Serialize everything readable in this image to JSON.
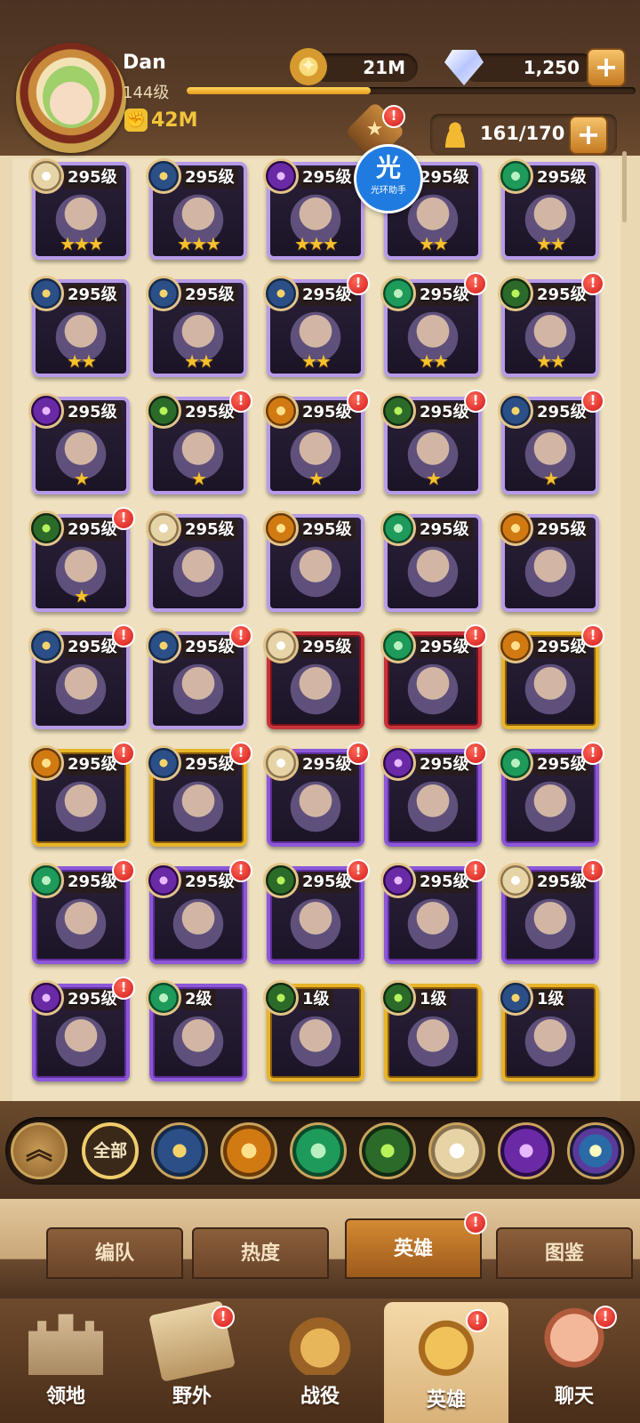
{
  "player": {
    "name": "Dan",
    "level": "144级",
    "power": "42M",
    "xp_progress": 0.41
  },
  "resources": {
    "gold": "21M",
    "diamonds": "1,250"
  },
  "roster": {
    "count": "161/170"
  },
  "watermark": {
    "symbol": "光",
    "label": "光环助手"
  },
  "colors": {
    "accent_gold": "#e8b428",
    "badge_red": "#d21a1a"
  },
  "heroes": [
    {
      "level": "295级",
      "stars": "★★★",
      "rarity": "lavender",
      "faction": "celestial",
      "badge": false
    },
    {
      "level": "295级",
      "stars": "★★★",
      "rarity": "lavender",
      "faction": "lightbearer",
      "badge": false
    },
    {
      "level": "295级",
      "stars": "★★★",
      "rarity": "lavender",
      "faction": "hypogean",
      "badge": false
    },
    {
      "level": "295级",
      "stars": "★★",
      "rarity": "lavender",
      "faction": "dimensional",
      "badge": false
    },
    {
      "level": "295级",
      "stars": "★★",
      "rarity": "lavender",
      "faction": "wilder",
      "badge": false
    },
    {
      "level": "295级",
      "stars": "★★",
      "rarity": "lavender",
      "faction": "lightbearer",
      "badge": false
    },
    {
      "level": "295级",
      "stars": "★★",
      "rarity": "lavender",
      "faction": "lightbearer",
      "badge": false
    },
    {
      "level": "295级",
      "stars": "★★",
      "rarity": "lavender",
      "faction": "lightbearer",
      "badge": true
    },
    {
      "level": "295级",
      "stars": "★★",
      "rarity": "lavender",
      "faction": "wilder",
      "badge": true
    },
    {
      "level": "295级",
      "stars": "★★",
      "rarity": "lavender",
      "faction": "graveborn",
      "badge": true
    },
    {
      "level": "295级",
      "stars": "★",
      "rarity": "lavender",
      "faction": "hypogean",
      "badge": false
    },
    {
      "level": "295级",
      "stars": "★",
      "rarity": "lavender",
      "faction": "graveborn",
      "badge": true
    },
    {
      "level": "295级",
      "stars": "★",
      "rarity": "lavender",
      "faction": "mauler",
      "badge": true
    },
    {
      "level": "295级",
      "stars": "★",
      "rarity": "lavender",
      "faction": "graveborn",
      "badge": true
    },
    {
      "level": "295级",
      "stars": "★",
      "rarity": "lavender",
      "faction": "lightbearer",
      "badge": true
    },
    {
      "level": "295级",
      "stars": "★",
      "rarity": "lavender",
      "faction": "graveborn",
      "badge": true
    },
    {
      "level": "295级",
      "stars": "",
      "rarity": "lavender",
      "faction": "celestial",
      "badge": false
    },
    {
      "level": "295级",
      "stars": "",
      "rarity": "lavender",
      "faction": "mauler",
      "badge": false
    },
    {
      "level": "295级",
      "stars": "",
      "rarity": "lavender",
      "faction": "wilder",
      "badge": false
    },
    {
      "level": "295级",
      "stars": "",
      "rarity": "lavender",
      "faction": "mauler",
      "badge": false
    },
    {
      "level": "295级",
      "stars": "",
      "rarity": "lavender",
      "faction": "lightbearer",
      "badge": true
    },
    {
      "level": "295级",
      "stars": "",
      "rarity": "lavender",
      "faction": "lightbearer",
      "badge": true
    },
    {
      "level": "295级",
      "stars": "",
      "rarity": "red",
      "faction": "celestial",
      "badge": false
    },
    {
      "level": "295级",
      "stars": "",
      "rarity": "red",
      "faction": "wilder",
      "badge": true
    },
    {
      "level": "295级",
      "stars": "",
      "rarity": "gold",
      "faction": "mauler",
      "badge": true
    },
    {
      "level": "295级",
      "stars": "",
      "rarity": "gold",
      "faction": "mauler",
      "badge": true
    },
    {
      "level": "295级",
      "stars": "",
      "rarity": "gold",
      "faction": "lightbearer",
      "badge": true
    },
    {
      "level": "295级",
      "stars": "",
      "rarity": "purple",
      "faction": "celestial",
      "badge": true
    },
    {
      "level": "295级",
      "stars": "",
      "rarity": "purple",
      "faction": "hypogean",
      "badge": true
    },
    {
      "level": "295级",
      "stars": "",
      "rarity": "purple",
      "faction": "wilder",
      "badge": true
    },
    {
      "level": "295级",
      "stars": "",
      "rarity": "purple",
      "faction": "wilder",
      "badge": true
    },
    {
      "level": "295级",
      "stars": "",
      "rarity": "purple",
      "faction": "hypogean",
      "badge": true
    },
    {
      "level": "295级",
      "stars": "",
      "rarity": "purple",
      "faction": "graveborn",
      "badge": true
    },
    {
      "level": "295级",
      "stars": "",
      "rarity": "purple",
      "faction": "hypogean",
      "badge": true
    },
    {
      "level": "295级",
      "stars": "",
      "rarity": "purple",
      "faction": "celestial",
      "badge": true
    },
    {
      "level": "295级",
      "stars": "",
      "rarity": "purple",
      "faction": "hypogean",
      "badge": true
    },
    {
      "level": "2级",
      "stars": "",
      "rarity": "purple",
      "faction": "wilder",
      "badge": false
    },
    {
      "level": "1级",
      "stars": "",
      "rarity": "gold",
      "faction": "graveborn",
      "badge": false
    },
    {
      "level": "1级",
      "stars": "",
      "rarity": "gold",
      "faction": "graveborn",
      "badge": false
    },
    {
      "level": "1级",
      "stars": "",
      "rarity": "gold",
      "faction": "lightbearer",
      "badge": false
    }
  ],
  "filters": {
    "all_label": "全部",
    "items": [
      {
        "icon": "lightbearer-faction-icon"
      },
      {
        "icon": "mauler-faction-icon"
      },
      {
        "icon": "wilder-faction-icon"
      },
      {
        "icon": "graveborn-faction-icon"
      },
      {
        "icon": "celestial-faction-icon"
      },
      {
        "icon": "hypogean-faction-icon"
      },
      {
        "icon": "dimensional-faction-icon"
      }
    ]
  },
  "subtabs": [
    {
      "label": "编队",
      "active": false,
      "badge": false
    },
    {
      "label": "热度",
      "active": false,
      "badge": false
    },
    {
      "label": "英雄",
      "active": true,
      "badge": true
    },
    {
      "label": "图鉴",
      "active": false,
      "badge": false
    }
  ],
  "nav": [
    {
      "label": "领地",
      "icon": "castle-icon",
      "active": false,
      "badge": false
    },
    {
      "label": "野外",
      "icon": "scroll-map-icon",
      "active": false,
      "badge": true
    },
    {
      "label": "战役",
      "icon": "crossed-swords-icon",
      "active": false,
      "badge": false
    },
    {
      "label": "英雄",
      "icon": "helmet-icon",
      "active": true,
      "badge": true
    },
    {
      "label": "聊天",
      "icon": "chat-bubble-icon",
      "active": false,
      "badge": true
    }
  ]
}
